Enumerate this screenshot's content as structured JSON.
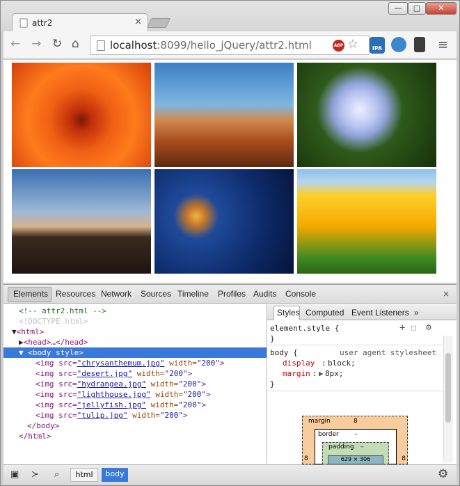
{
  "browser": {
    "tab_title": "attr2",
    "url_host": "localhost",
    "url_rest": ":8099/hello_jQuery/attr2.html",
    "abp_label": "ABP",
    "ext1_label": "IPA",
    "window_buttons": {
      "min": "—",
      "max": "□",
      "close": "✕"
    },
    "nav_icons": {
      "back": "←",
      "forward": "→",
      "reload": "↻",
      "home": "⌂",
      "star": "☆",
      "menu": "≡"
    }
  },
  "page": {
    "images": [
      {
        "name": "chrysanthemum",
        "color": "#f06014"
      },
      {
        "name": "desert",
        "color": "#a84d1d"
      },
      {
        "name": "hydrangea",
        "color": "#b8c4f0"
      },
      {
        "name": "lighthouse",
        "color": "#3b2a1e"
      },
      {
        "name": "jellyfish",
        "color": "#0d2a6a"
      },
      {
        "name": "tulip",
        "color": "#ffcf2a"
      }
    ]
  },
  "devtools": {
    "tabs": [
      "Elements",
      "Resources",
      "Network",
      "Sources",
      "Timeline",
      "Profiles",
      "Audits",
      "Console"
    ],
    "close": "×",
    "dom": {
      "comment": "<!-- attr2.html -->",
      "doctype": "<!DOCTYPE html>",
      "html_open": "<html>",
      "head_collapsed": "<head>…</head>",
      "body_open_tag": "<body",
      "body_attr": " style",
      "body_close_bracket": ">",
      "img_tag": "<img src=",
      "width_attr": " width=",
      "width_val": "\"200\"",
      "img_end": ">",
      "imgs": [
        "\"chrysanthemum.jpg\"",
        "\"desert.jpg\"",
        "\"hydrangea.jpg\"",
        "\"lighthouse.jpg\"",
        "\"jellyfish.jpg\"",
        "\"tulip.jpg\""
      ],
      "body_close": "</body>",
      "html_close": "</html>"
    },
    "sidebar": {
      "tabs": [
        "Styles",
        "Computed",
        "Event Listeners"
      ],
      "more": "»",
      "element_style": "element.style {",
      "close_brace": "}",
      "body_rule": "body {",
      "ua_label": "user agent stylesheet",
      "prop_display": "display",
      "val_display": "block;",
      "prop_margin": "margin",
      "val_margin": "8px;",
      "box": {
        "margin_label": "margin",
        "margin_val": "8",
        "border_label": "border",
        "border_val": "–",
        "padding_label": "padding",
        "padding_val": "–",
        "content": "629 × 306",
        "side_val": "8"
      }
    },
    "bottom": {
      "crumb_html": "html",
      "crumb_body": "body"
    }
  }
}
